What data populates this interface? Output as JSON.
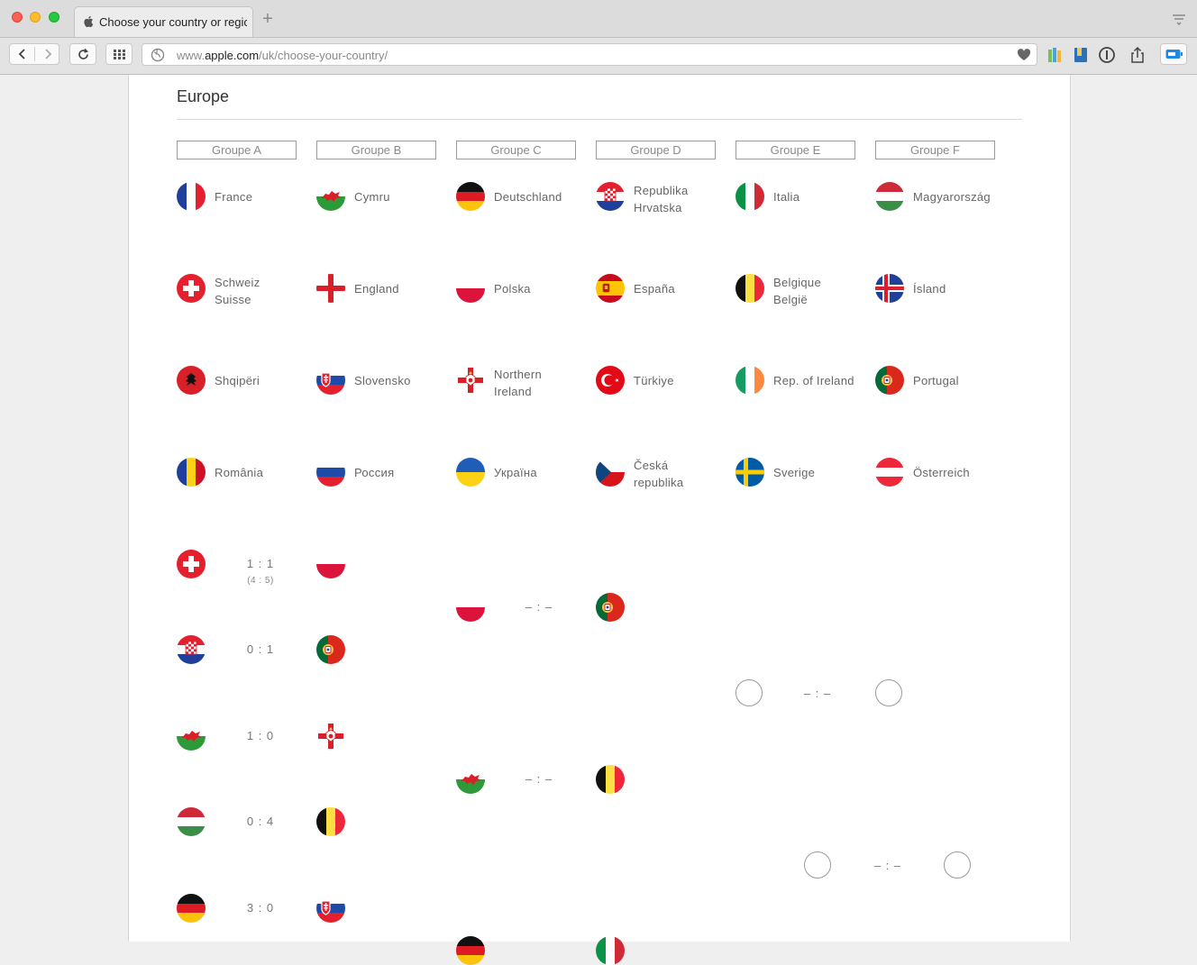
{
  "browser": {
    "tab_title": "Choose your country or region",
    "new_tab_label": "+",
    "url_prefix": "www.",
    "url_domain": "apple.com",
    "url_path": "/uk/choose-your-country/"
  },
  "page": {
    "region_title": "Europe",
    "groups": [
      "Groupe A",
      "Groupe B",
      "Groupe C",
      "Groupe D",
      "Groupe E",
      "Groupe F"
    ],
    "teams": [
      [
        "France",
        "Schweiz\nSuisse",
        "Shqipëri",
        "România"
      ],
      [
        "Cymru",
        "England",
        "Slovensko",
        "Россия"
      ],
      [
        "Deutschland",
        "Polska",
        "Northern\nIreland",
        "Україна"
      ],
      [
        "Republika\nHrvatska",
        "España",
        "Türkiye",
        "Česká\nrepublika"
      ],
      [
        "Italia",
        "Belgique\nBelgië",
        "Rep. of Ireland",
        "Sverige"
      ],
      [
        "Magyarország",
        "Ísland",
        "Portugal",
        "Österreich"
      ]
    ],
    "round_of_16": [
      {
        "home": "switzerland-flag",
        "away": "poland-flag",
        "score": "1 : 1",
        "penalties": "(4 : 5)"
      },
      {
        "home": "croatia-flag",
        "away": "portugal-flag",
        "score": "0 : 1",
        "penalties": ""
      },
      {
        "home": "wales-flag",
        "away": "northern-ireland-flag",
        "score": "1 : 0",
        "penalties": ""
      },
      {
        "home": "hungary-flag",
        "away": "belgium-flag",
        "score": "0 : 4",
        "penalties": ""
      },
      {
        "home": "germany-flag",
        "away": "slovakia-flag",
        "score": "3 : 0",
        "penalties": ""
      }
    ],
    "quarter_finals": [
      {
        "home": "poland-flag",
        "away": "portugal-flag",
        "score": "– : –"
      },
      {
        "home": "wales-flag",
        "away": "belgium-flag",
        "score": "– : –"
      }
    ],
    "semi_final": {
      "score": "– : –"
    },
    "final": {
      "score": "– : –"
    }
  },
  "colors": {
    "page_bg": "#ffffff",
    "outer_bg": "#efefef",
    "text": "#666666",
    "header_border": "#9a9a9a"
  }
}
